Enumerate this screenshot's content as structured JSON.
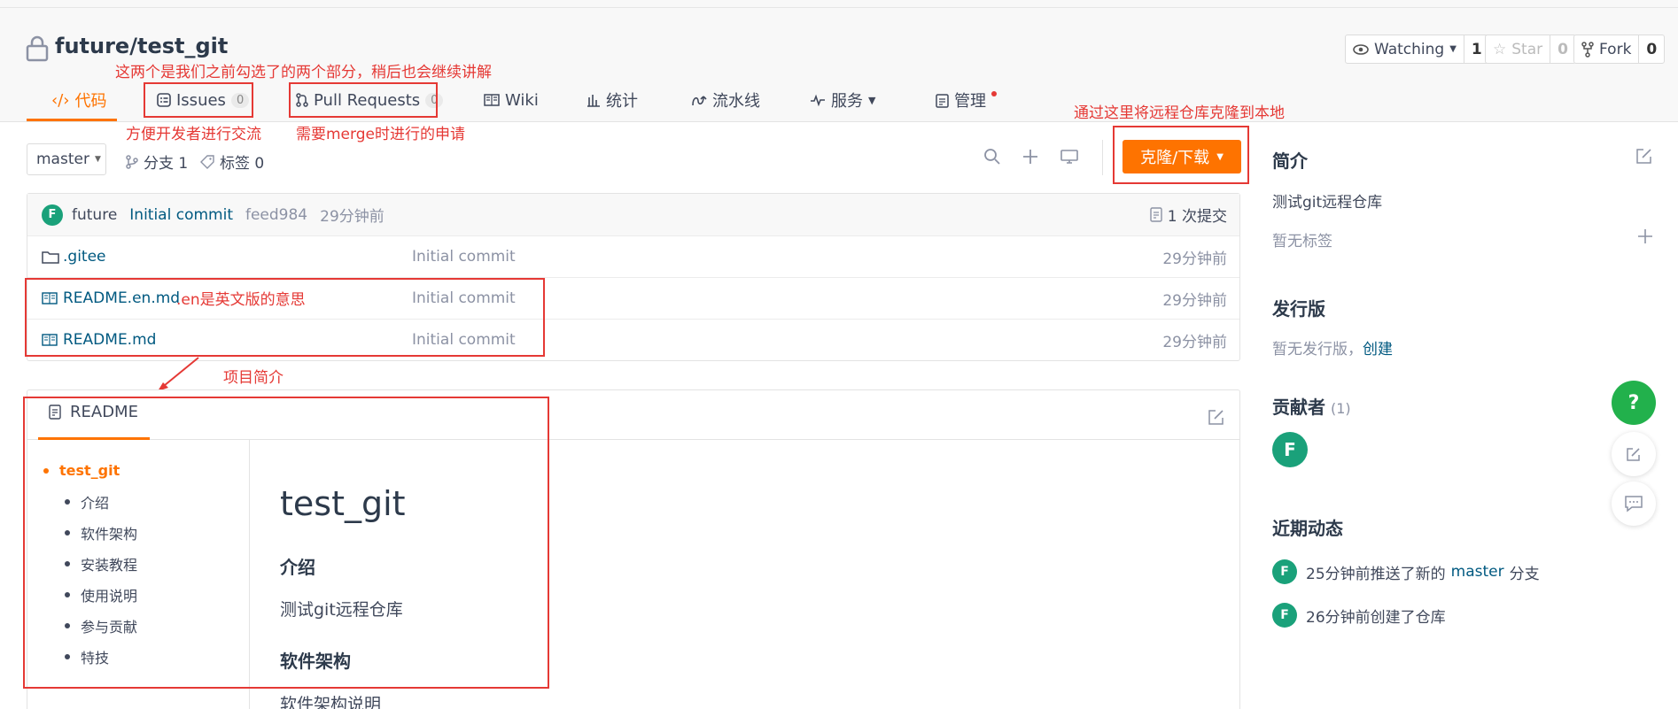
{
  "header": {
    "repo_path": "future/test_git",
    "watching": {
      "label": "Watching",
      "count": "1"
    },
    "star": {
      "label": "Star",
      "count": "0"
    },
    "fork": {
      "label": "Fork",
      "count": "0"
    }
  },
  "tabs": [
    {
      "label": "代码",
      "icon": "code-icon"
    },
    {
      "label": "Issues",
      "badge": "0",
      "icon": "issues-icon"
    },
    {
      "label": "Pull Requests",
      "badge": "0",
      "icon": "pull-request-icon"
    },
    {
      "label": "Wiki",
      "icon": "book-icon"
    },
    {
      "label": "统计",
      "icon": "bar-chart-icon"
    },
    {
      "label": "流水线",
      "icon": "pipeline-icon"
    },
    {
      "label": "服务",
      "icon": "pulse-icon"
    },
    {
      "label": "管理",
      "icon": "clipboard-icon"
    }
  ],
  "annotations": {
    "tabs_note": "这两个是我们之前勾选了的两个部分，稍后也会继续讲解",
    "issues_note": "方便开发者进行交流",
    "pr_note": "需要merge时进行的申请",
    "clone_note": "通过这里将远程仓库克隆到本地",
    "en_note": ".en是英文版的意思",
    "readme_note": "项目简介"
  },
  "toolbar": {
    "branch": "master",
    "branches": "分支 1",
    "tags": "标签 0",
    "clone_label": "克隆/下载"
  },
  "commit": {
    "avatar_letter": "F",
    "author": "future",
    "message": "Initial commit",
    "hash": "feed984",
    "time": "29分钟前",
    "count": "1 次提交"
  },
  "files": [
    {
      "name": ".gitee",
      "type": "folder",
      "message": "Initial commit",
      "time": "29分钟前"
    },
    {
      "name": "README.en.md",
      "type": "book",
      "message": "Initial commit",
      "time": "29分钟前"
    },
    {
      "name": "README.md",
      "type": "book",
      "message": "Initial commit",
      "time": "29分钟前"
    }
  ],
  "readme": {
    "tab_label": "README",
    "toc": [
      "test_git",
      "介绍",
      "软件架构",
      "安装教程",
      "使用说明",
      "参与贡献",
      "特技"
    ],
    "title": "test_git",
    "h_intro": "介绍",
    "intro_text": "测试git远程仓库",
    "h_arch": "软件架构",
    "arch_text": "软件架构说明"
  },
  "sidebar": {
    "intro_title": "简介",
    "description": "测试git远程仓库",
    "no_tags": "暂无标签",
    "release_title": "发行版",
    "no_release": "暂无发行版，",
    "create_link": "创建",
    "contrib_title": "贡献者",
    "contrib_count": "(1)",
    "contrib_avatar": "F",
    "activity_title": "近期动态",
    "activity": [
      {
        "avatar": "F",
        "pre": "25分钟前推送了新的",
        "branch": "master",
        "post": "分支"
      },
      {
        "avatar": "F",
        "pre": "26分钟前创建了仓库",
        "branch": "",
        "post": ""
      }
    ]
  },
  "fab": {
    "help_label": "?"
  },
  "colors": {
    "accent": "#fe7300",
    "annotation": "#e53935",
    "avatar": "#1aa17a",
    "link": "#005980",
    "help": "#22b14c"
  }
}
